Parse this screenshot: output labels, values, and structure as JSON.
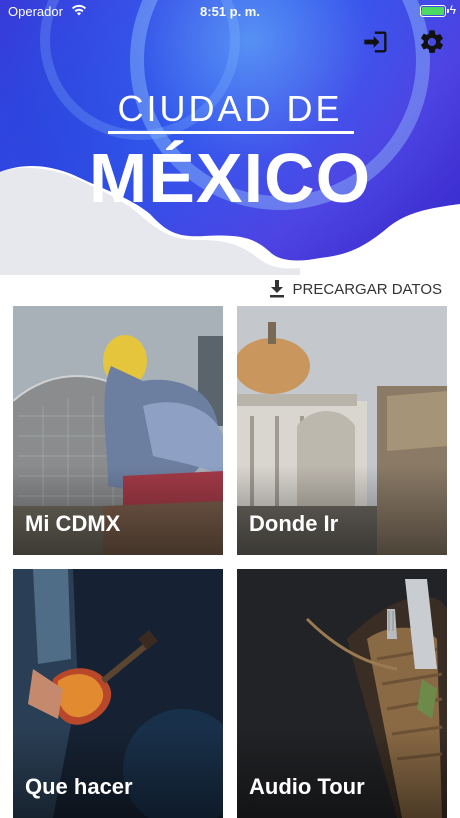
{
  "status_bar": {
    "carrier": "Operador",
    "time": "8:51 p. m.",
    "battery_color": "#4cd964"
  },
  "header": {
    "title_line1": "CIUDAD DE",
    "title_line2": "MÉXICO",
    "background_color": "#3b39d8",
    "actions": [
      {
        "icon": "login-icon"
      },
      {
        "icon": "gear-icon"
      }
    ]
  },
  "preload": {
    "icon": "download-icon",
    "label": "PRECARGAR DATOS"
  },
  "tiles": [
    {
      "label": "Mi CDMX"
    },
    {
      "label": "Donde Ir"
    },
    {
      "label": "Que hacer"
    },
    {
      "label": "Audio Tour"
    }
  ]
}
